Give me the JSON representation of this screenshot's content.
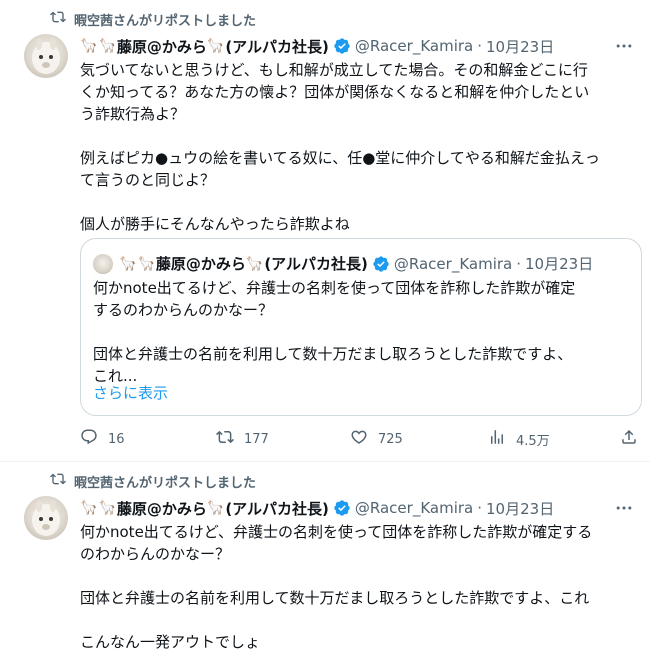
{
  "tweets": [
    {
      "repost_label": "暇空茜さんがリポストしました",
      "author": {
        "name": "藤原@かみら",
        "name_suffix": "(アルパカ社長)",
        "handle": "@Racer_Kamira",
        "date": "10月23日"
      },
      "text_blocks": [
        [
          "気づいてないと思うけど、もし和解が成立してた場合。その和解金どこに行",
          "くか知ってる？あなた方の懐よ？団体が関係なくなると和解を仲介したとい",
          "う詐欺行為よ？"
        ],
        [
          "例えばピカ●ュウの絵を書いてる奴に、任●堂に仲介してやる和解だ金払えっ",
          "て言うのと同じよ？"
        ],
        [
          "個人が勝手にそんなんやったら詐欺よね"
        ]
      ],
      "quote": {
        "author": {
          "name": "藤原@かみら",
          "name_suffix": "(アルパカ社長)",
          "handle": "@Racer_Kamira",
          "date": "10月23日"
        },
        "text_blocks": [
          [
            "何かnote出てるけど、弁護士の名刺を使って団体を詐称した詐欺が確定",
            "するのわからんのかなー？"
          ],
          [
            "団体と弁護士の名前を利用して数十万だまし取ろうとした詐欺ですよ、",
            "これ..."
          ]
        ],
        "show_more": "さらに表示"
      },
      "stats": {
        "replies": "16",
        "reposts": "177",
        "likes": "725",
        "views": "4.5万"
      }
    },
    {
      "repost_label": "暇空茜さんがリポストしました",
      "author": {
        "name": "藤原@かみら",
        "name_suffix": "(アルパカ社長)",
        "handle": "@Racer_Kamira",
        "date": "10月23日"
      },
      "text_blocks": [
        [
          "何かnote出てるけど、弁護士の名刺を使って団体を詐称した詐欺が確定する",
          "のわからんのかなー？"
        ],
        [
          "団体と弁護士の名前を利用して数十万だまし取ろうとした詐欺ですよ、これ"
        ],
        [
          "こんなん一発アウトでしょ"
        ]
      ]
    }
  ],
  "colors": {
    "text": "#0f1419",
    "secondary": "#536471",
    "accent": "#1d9bf0",
    "border": "#cfd9de"
  }
}
